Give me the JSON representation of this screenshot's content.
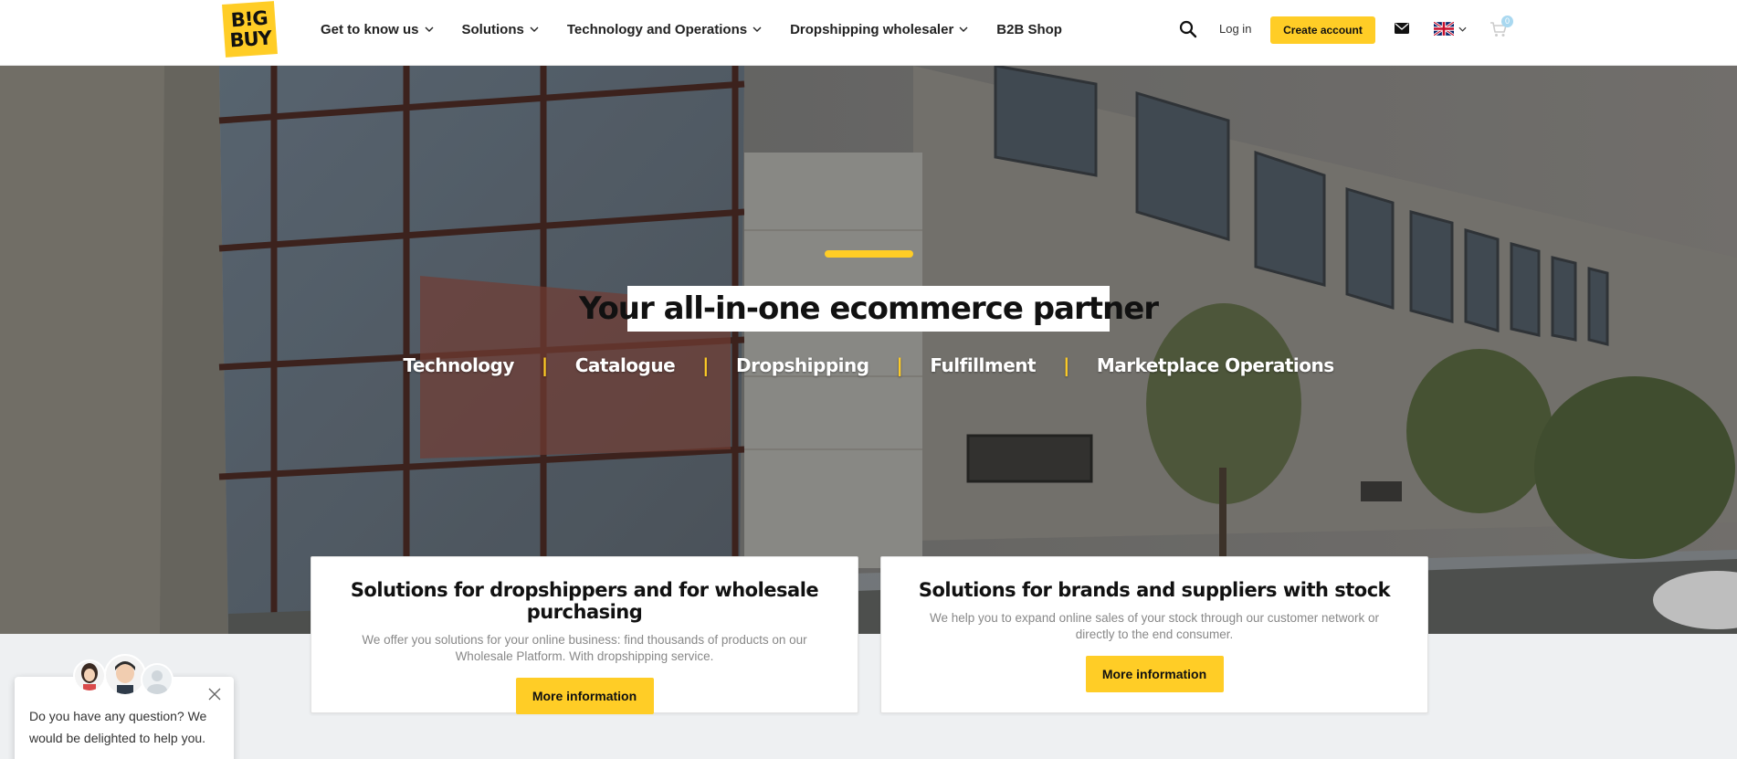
{
  "header": {
    "logo_line1": "B!G",
    "logo_line2": "BUY",
    "nav": [
      {
        "label": "Get to know us",
        "has_dropdown": true
      },
      {
        "label": "Solutions",
        "has_dropdown": true
      },
      {
        "label": "Technology and Operations",
        "has_dropdown": true
      },
      {
        "label": "Dropshipping wholesaler",
        "has_dropdown": true
      },
      {
        "label": "B2B Shop",
        "has_dropdown": false
      }
    ],
    "login_label": "Log in",
    "create_account_label": "Create account",
    "cart_count": "0",
    "language_icon": "uk-flag-icon"
  },
  "hero": {
    "title": "Your all-in-one ecommerce partner",
    "tags": [
      "Technology",
      "Catalogue",
      "Dropshipping",
      "Fulfillment",
      "Marketplace Operations"
    ],
    "separator": "|"
  },
  "cards": [
    {
      "title": "Solutions for dropshippers and for wholesale purchasing",
      "text": "We offer you solutions for your online business: find thousands of products on our Wholesale Platform. With dropshipping service.",
      "button": "More information"
    },
    {
      "title": "Solutions for brands and suppliers with stock",
      "text": "We help you to expand online sales of your stock through our customer network or directly to the end consumer.",
      "button": "More information"
    }
  ],
  "chat": {
    "message": "Do you have any question? We would be delighted to help you."
  },
  "colors": {
    "accent": "#ffcd26",
    "text": "#222222",
    "muted": "#888888",
    "page_bg": "#eef0f2"
  }
}
